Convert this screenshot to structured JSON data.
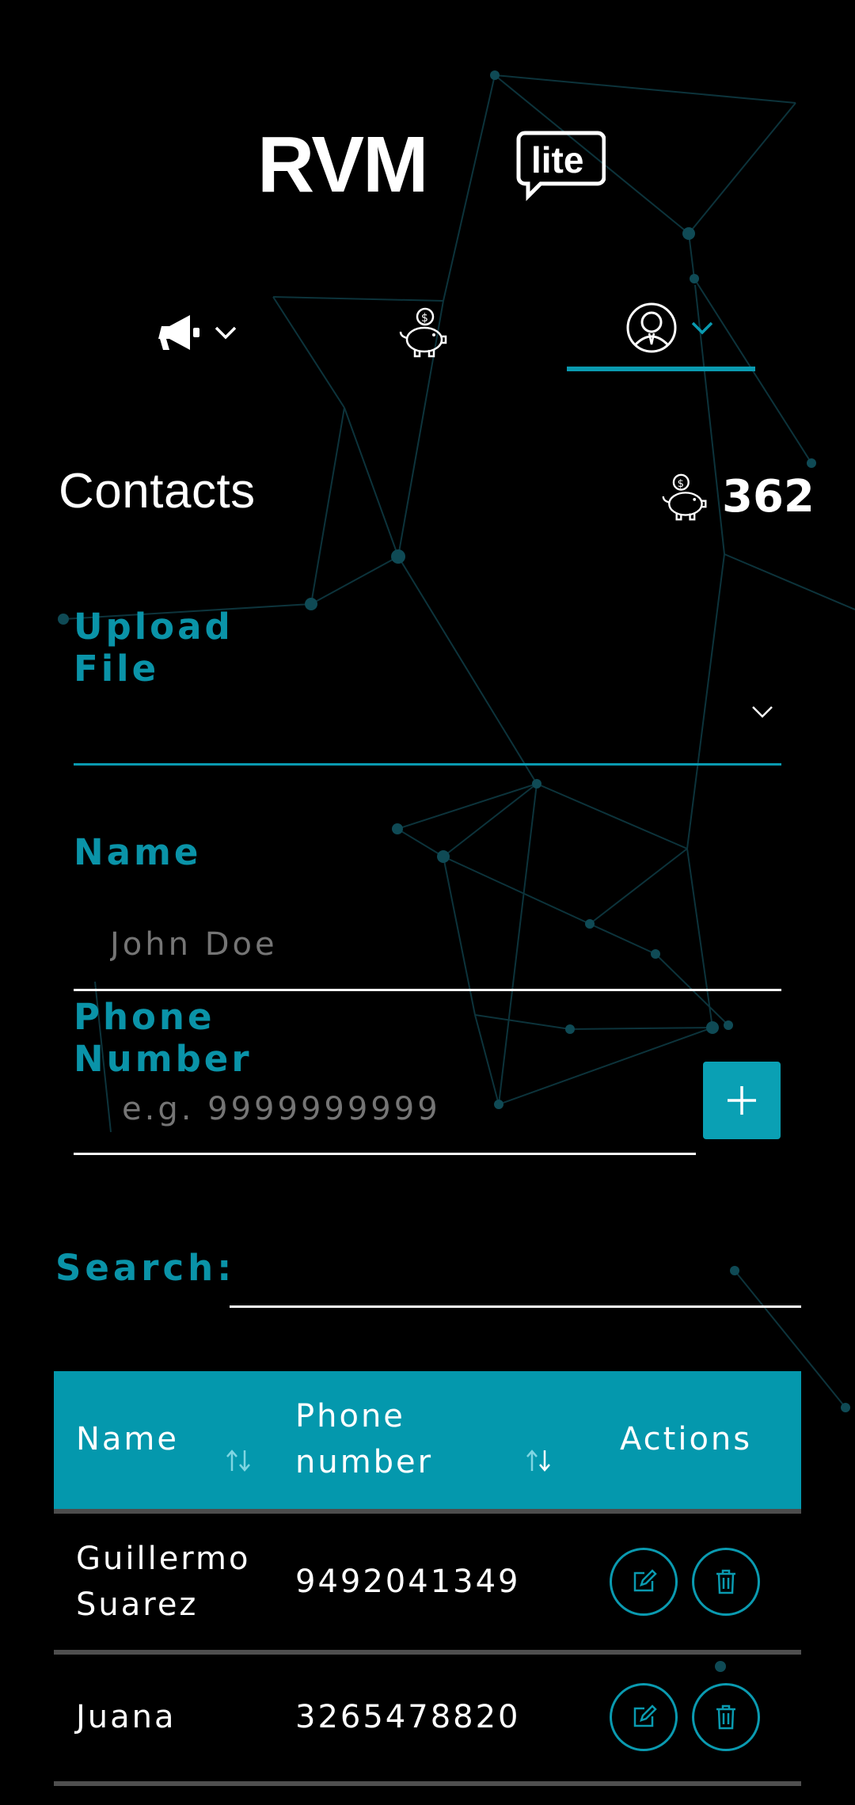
{
  "app": {
    "logo_text": "RVM",
    "logo_badge": "lite"
  },
  "nav": {
    "items": [
      {
        "icon": "megaphone-icon",
        "has_dropdown": true,
        "active": false
      },
      {
        "icon": "piggy-bank-icon",
        "has_dropdown": false,
        "active": false
      },
      {
        "icon": "user-avatar-icon",
        "has_dropdown": true,
        "active": true
      }
    ]
  },
  "header": {
    "title": "Contacts",
    "credits": "362",
    "credits_icon": "piggy-bank-icon"
  },
  "form": {
    "upload_label": "Upload File",
    "upload_value": "",
    "name_label": "Name",
    "name_placeholder": "John Doe",
    "phone_label": "Phone Number",
    "phone_placeholder": "e.g. 9999999999",
    "add_icon": "plus-icon"
  },
  "search": {
    "label": "Search:",
    "value": ""
  },
  "table": {
    "columns": [
      "Name",
      "Phone number",
      "Actions"
    ],
    "rows": [
      {
        "name": "Guillermo Suarez",
        "phone": "9492041349"
      },
      {
        "name": "Juana",
        "phone": "3265478820"
      }
    ]
  },
  "colors": {
    "accent": "#0a9ab0",
    "background": "#000000",
    "header_bg": "#0498ad"
  }
}
